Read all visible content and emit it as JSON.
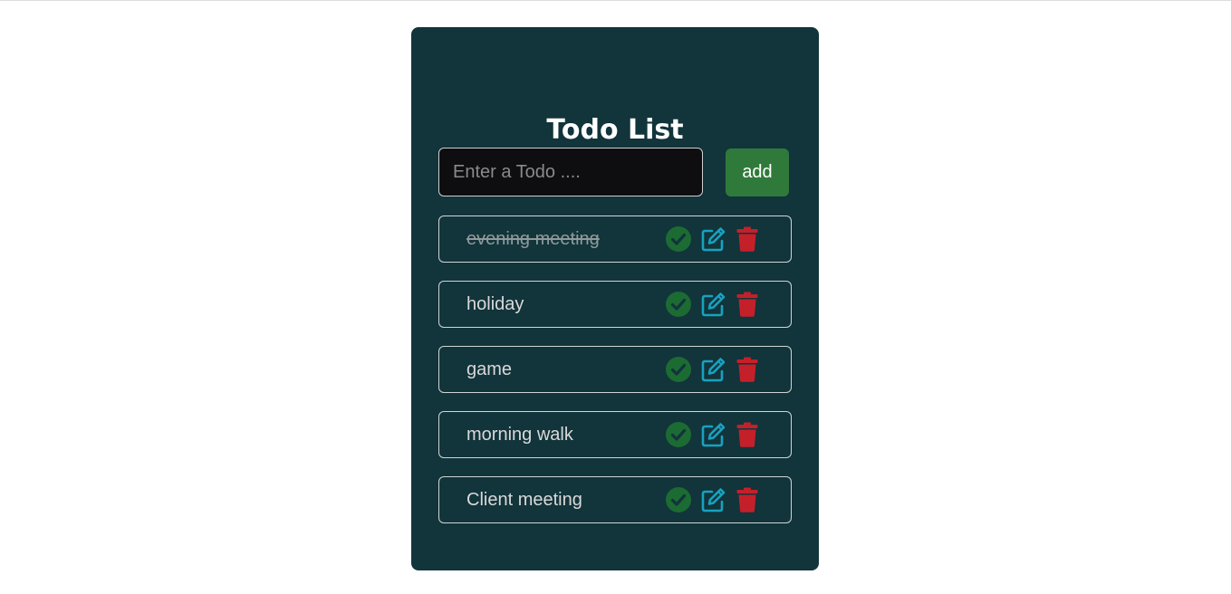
{
  "app": {
    "title": "Todo List"
  },
  "input": {
    "placeholder": "Enter a Todo ....",
    "value": ""
  },
  "add_button": {
    "label": "add"
  },
  "todos": [
    {
      "text": "evening meeting",
      "completed": true
    },
    {
      "text": "holiday",
      "completed": false
    },
    {
      "text": "game",
      "completed": false
    },
    {
      "text": "morning walk",
      "completed": false
    },
    {
      "text": "Client meeting",
      "completed": false
    }
  ],
  "icons": {
    "complete": "check-circle-icon",
    "edit": "edit-icon",
    "delete": "trash-icon"
  },
  "colors": {
    "background": "#ffffff",
    "card": "#12343b",
    "input_bg": "#0e0e10",
    "add_button": "#2f7a3a",
    "check": "#1c6b33",
    "edit": "#17a2c0",
    "delete": "#c4202a",
    "text": "#d9d9d9"
  }
}
